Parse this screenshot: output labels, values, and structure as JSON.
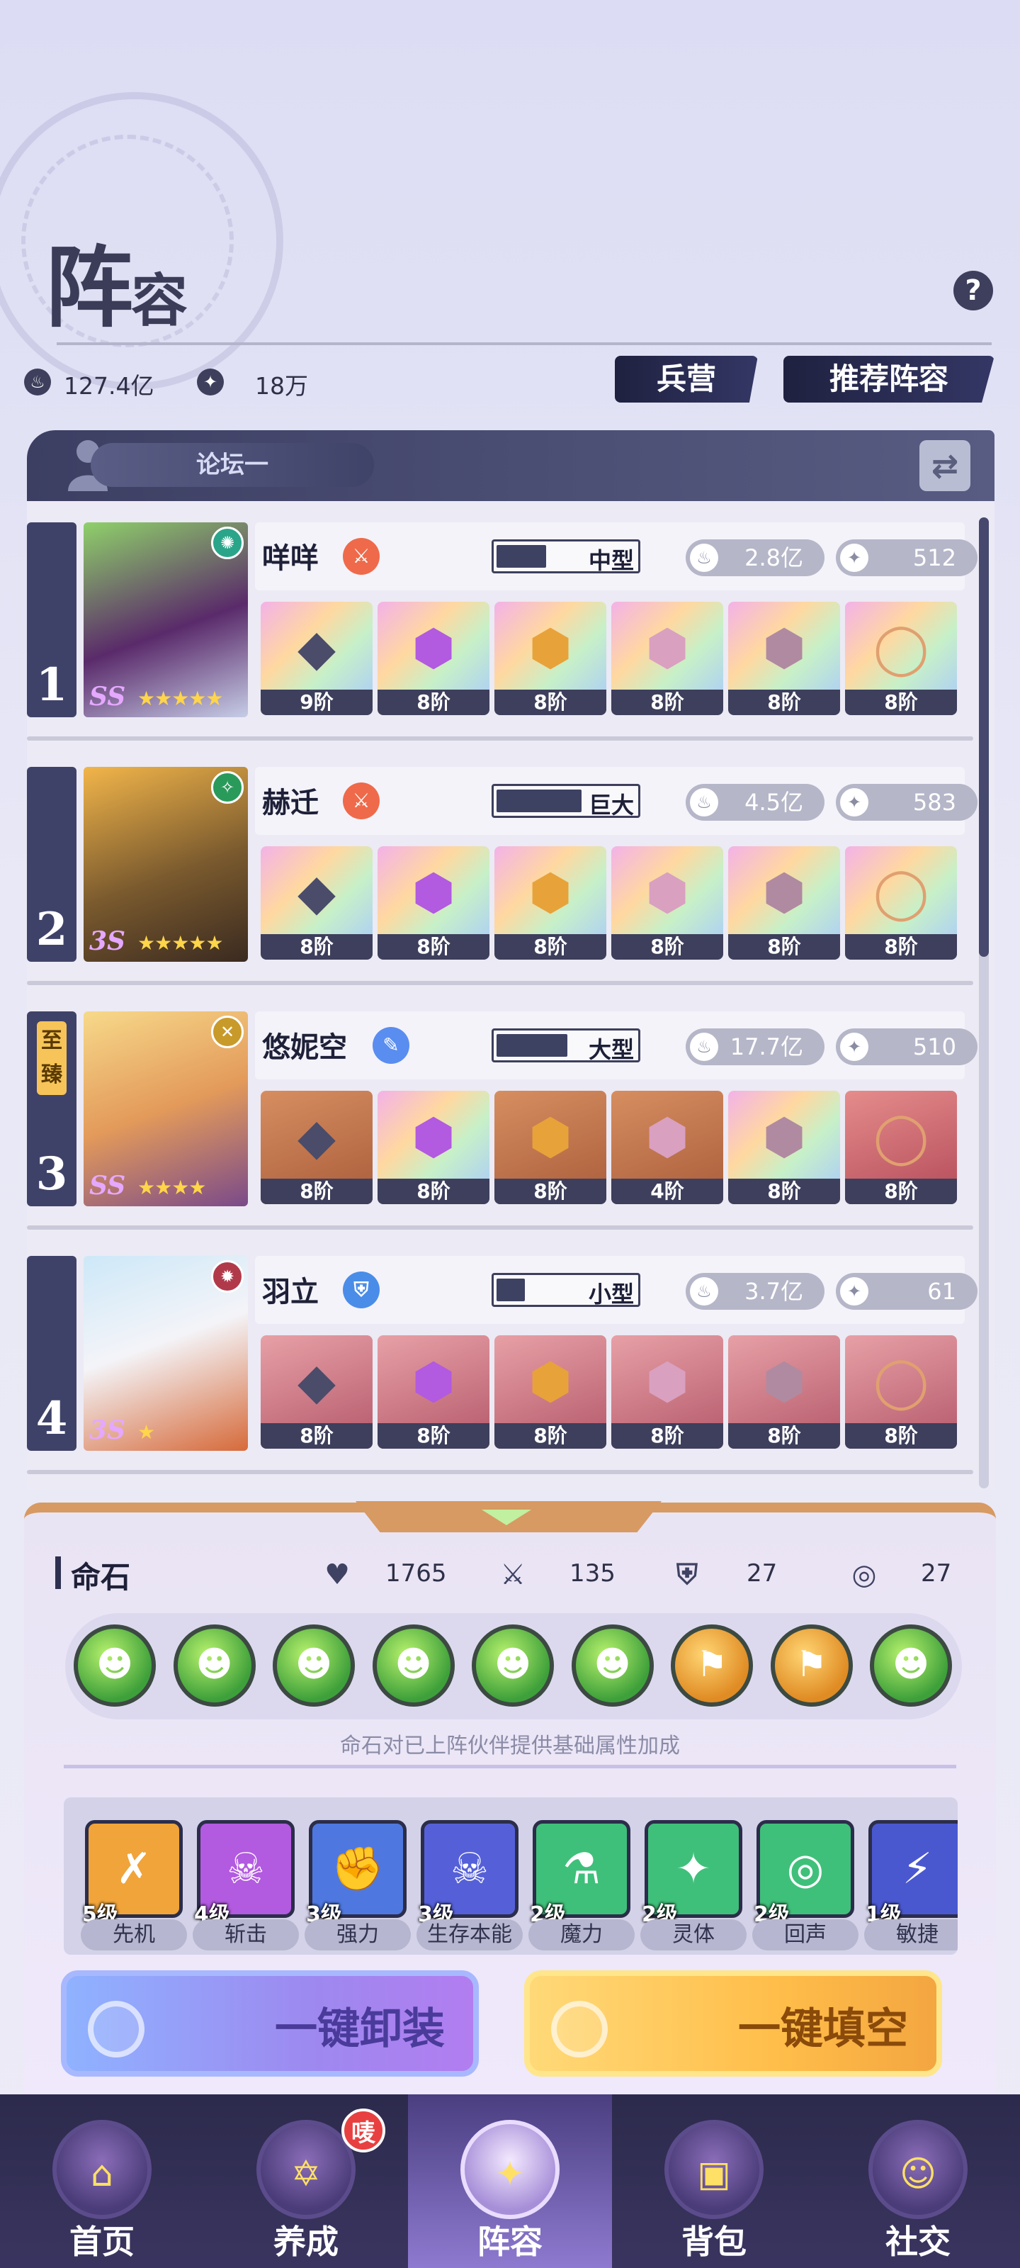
{
  "header": {
    "title_a": "阵",
    "title_b": "容",
    "help_label": "?"
  },
  "stats": {
    "power": "127.4亿",
    "stars": "18万"
  },
  "top_buttons": {
    "barracks": "兵营",
    "recommend": "推荐阵容"
  },
  "team": {
    "name": "论坛一"
  },
  "heroes": [
    {
      "index": "1",
      "tag": "",
      "name": "咩咩",
      "rank": "SS",
      "stars": "★★★★★",
      "class_color": "#ef6a4a",
      "size": "中型",
      "size_fill": 0.35,
      "power": "2.8亿",
      "score": "512",
      "gear": [
        {
          "label": "9阶",
          "color": "rainbow"
        },
        {
          "label": "8阶",
          "color": "rainbow"
        },
        {
          "label": "8阶",
          "color": "rainbow"
        },
        {
          "label": "8阶",
          "color": "rainbow"
        },
        {
          "label": "8阶",
          "color": "rainbow"
        },
        {
          "label": "8阶",
          "color": "rainbow"
        }
      ]
    },
    {
      "index": "2",
      "tag": "",
      "name": "赫迁",
      "rank": "3S",
      "stars": "★★★★★",
      "class_color": "#ef6a4a",
      "size": "巨大",
      "size_fill": 0.6,
      "power": "4.5亿",
      "score": "583",
      "gear": [
        {
          "label": "8阶",
          "color": "rainbow"
        },
        {
          "label": "8阶",
          "color": "rainbow"
        },
        {
          "label": "8阶",
          "color": "rainbow"
        },
        {
          "label": "8阶",
          "color": "rainbow"
        },
        {
          "label": "8阶",
          "color": "rainbow"
        },
        {
          "label": "8阶",
          "color": "rainbow"
        }
      ]
    },
    {
      "index": "3",
      "tag": "至臻",
      "name": "悠妮空",
      "rank": "SS",
      "stars": "★★★★",
      "class_color": "#5a8df0",
      "size": "大型",
      "size_fill": 0.5,
      "power": "17.7亿",
      "score": "510",
      "gear": [
        {
          "label": "8阶",
          "color": "brown"
        },
        {
          "label": "8阶",
          "color": "rainbow"
        },
        {
          "label": "8阶",
          "color": "brown"
        },
        {
          "label": "4阶",
          "color": "brown"
        },
        {
          "label": "8阶",
          "color": "rainbow"
        },
        {
          "label": "8阶",
          "color": "red"
        }
      ]
    },
    {
      "index": "4",
      "tag": "",
      "name": "羽立",
      "rank": "3S",
      "stars": "★",
      "class_color": "#4a8de8",
      "size": "小型",
      "size_fill": 0.2,
      "power": "3.7亿",
      "score": "61",
      "gear": [
        {
          "label": "8阶",
          "color": "pinkred"
        },
        {
          "label": "8阶",
          "color": "pinkred"
        },
        {
          "label": "8阶",
          "color": "pinkred"
        },
        {
          "label": "8阶",
          "color": "pinkred"
        },
        {
          "label": "8阶",
          "color": "pinkred"
        },
        {
          "label": "8阶",
          "color": "pinkred"
        }
      ]
    }
  ],
  "stones": {
    "title": "命石",
    "stats": [
      {
        "icon": "heart-icon",
        "value": "1765"
      },
      {
        "icon": "sword-icon",
        "value": "135"
      },
      {
        "icon": "shield-icon",
        "value": "27"
      },
      {
        "icon": "swirl-icon",
        "value": "27"
      }
    ],
    "gems": [
      {
        "color": "green"
      },
      {
        "color": "green"
      },
      {
        "color": "green"
      },
      {
        "color": "green"
      },
      {
        "color": "green"
      },
      {
        "color": "green"
      },
      {
        "color": "gold"
      },
      {
        "color": "gold"
      },
      {
        "color": "green"
      }
    ],
    "hint": "命石对已上阵伙伴提供基础属性加成"
  },
  "skills": [
    {
      "level": "5级",
      "name": "先机",
      "color": "#f0a43a"
    },
    {
      "level": "4级",
      "name": "斩击",
      "color": "#b25ae0"
    },
    {
      "level": "3级",
      "name": "强力",
      "color": "#4e78e0"
    },
    {
      "level": "3级",
      "name": "生存本能",
      "color": "#5560d8"
    },
    {
      "level": "2级",
      "name": "魔力",
      "color": "#3fc07a"
    },
    {
      "level": "2级",
      "name": "灵体",
      "color": "#3fc07a"
    },
    {
      "level": "2级",
      "name": "回声",
      "color": "#3fc07a"
    },
    {
      "level": "1级",
      "name": "敏捷",
      "color": "#4a58d0"
    }
  ],
  "actions": {
    "unload": "一键卸装",
    "fill": "一键填空"
  },
  "nav": [
    {
      "label": "首页",
      "active": false,
      "badge": ""
    },
    {
      "label": "养成",
      "active": false,
      "badge": "唛"
    },
    {
      "label": "阵容",
      "active": true,
      "badge": ""
    },
    {
      "label": "背包",
      "active": false,
      "badge": ""
    },
    {
      "label": "社交",
      "active": false,
      "badge": ""
    }
  ],
  "colors": {
    "accent": "#3d3f5c",
    "panel_edge": "#d79a62",
    "gem_green": "#3ea03a",
    "gem_gold": "#e08b23"
  }
}
